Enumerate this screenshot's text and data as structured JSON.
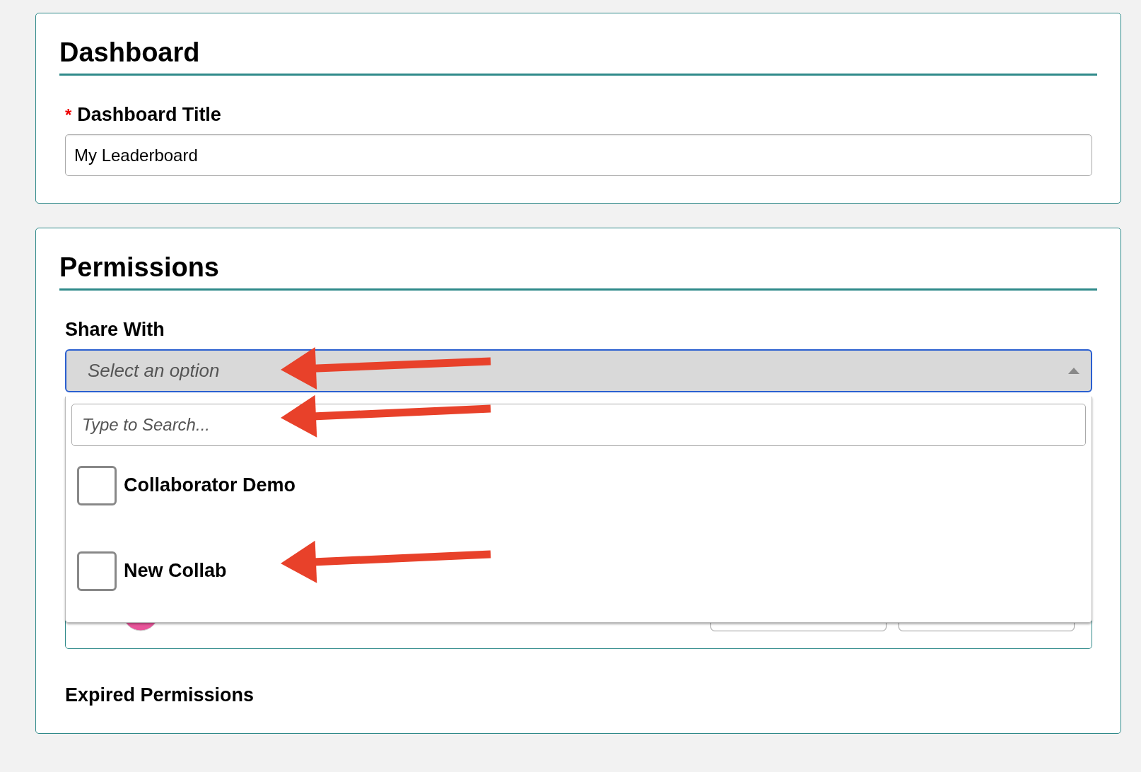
{
  "dashboard": {
    "heading": "Dashboard",
    "title_field": {
      "required_mark": "*",
      "label": "Dashboard Title",
      "value": "My Leaderboard"
    }
  },
  "permissions": {
    "heading": "Permissions",
    "share_with": {
      "label": "Share With",
      "placeholder": "Select an option",
      "expanded": true,
      "search": {
        "placeholder": "Type to Search..."
      },
      "options": [
        {
          "label": "Collaborator Demo",
          "checked": false
        },
        {
          "label": "New Collab",
          "checked": false
        }
      ]
    },
    "expired_label": "Expired Permissions"
  }
}
